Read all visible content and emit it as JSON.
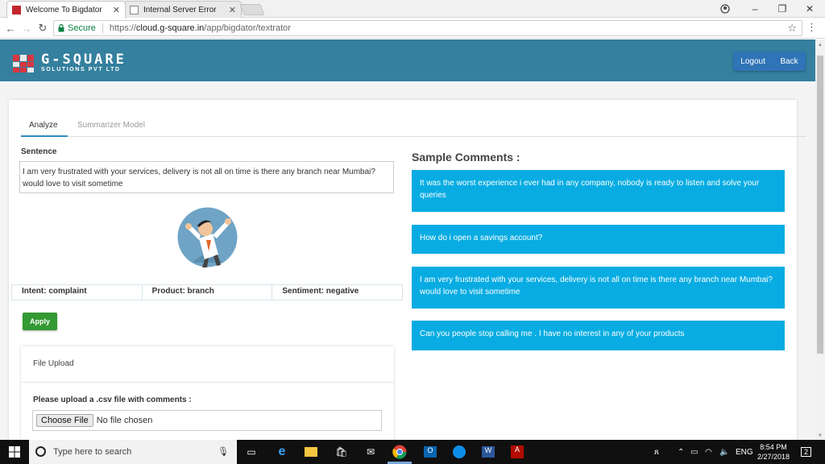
{
  "browser": {
    "tabs": [
      {
        "title": "Welcome To Bigdator",
        "active": true
      },
      {
        "title": "Internal Server Error",
        "active": false
      }
    ],
    "secure_label": "Secure",
    "url_prefix": "https://",
    "url_host": "cloud.g-square.in",
    "url_path": "/app/bigdator/textrator"
  },
  "header": {
    "logo_title": "G-SQUARE",
    "logo_subtitle": "SOLUTIONS PVT LTD",
    "logout_label": "Logout",
    "back_label": "Back",
    "color": "#34809e"
  },
  "page": {
    "tabs": [
      {
        "label": "Analyze",
        "active": true
      },
      {
        "label": "Summarizer Model",
        "active": false
      }
    ],
    "sentence_label": "Sentence",
    "sentence_value": "I am very frustrated with your services, delivery is not all on time is there any branch near Mumbai? would love to visit sometime",
    "results": {
      "intent": "Intent: complaint",
      "product": "Product: branch",
      "sentiment": "Sentiment: negative"
    },
    "apply_label": "Apply",
    "upload": {
      "title": "File Upload",
      "label": "Please upload a .csv file with comments :",
      "button_label": "Choose File",
      "status": "No file chosen"
    },
    "samples_title": "Sample Comments :",
    "samples": [
      "It was the worst experience i ever had in any company, nobody is ready to listen and solve your queries",
      "How do i open a savings account?",
      "I am very frustrated with your services, delivery is not all on time is there any branch near Mumbai? would love to visit sometime",
      "Can you people stop calling me . I have no interest in any of your products"
    ],
    "sample_color": "#08ace2",
    "apply_color": "#339933"
  },
  "taskbar": {
    "search_placeholder": "Type here to search",
    "language": "ENG",
    "time": "8:54 PM",
    "date": "2/27/2018",
    "notification_count": "2"
  }
}
